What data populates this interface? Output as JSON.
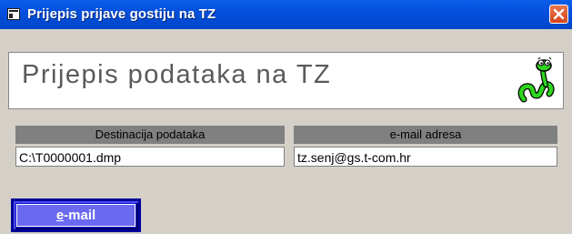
{
  "window": {
    "title": "Prijepis prijave gostiju na TZ",
    "icon": "form-icon",
    "close_icon": "close-icon"
  },
  "header": {
    "title": "Prijepis podataka na TZ",
    "logo": "worm-logo-icon"
  },
  "fields": {
    "destination_label": "Destinacija podataka",
    "destination_value": "C:\\T0000001.dmp",
    "email_label": "e-mail adresa",
    "email_value": "tz.senj@gs.t-com.hr"
  },
  "buttons": {
    "email_accel": "e",
    "email_rest": "-mail"
  },
  "colors": {
    "titlebar": "#0450de",
    "button": "#1414c8",
    "close": "#d5431b"
  }
}
